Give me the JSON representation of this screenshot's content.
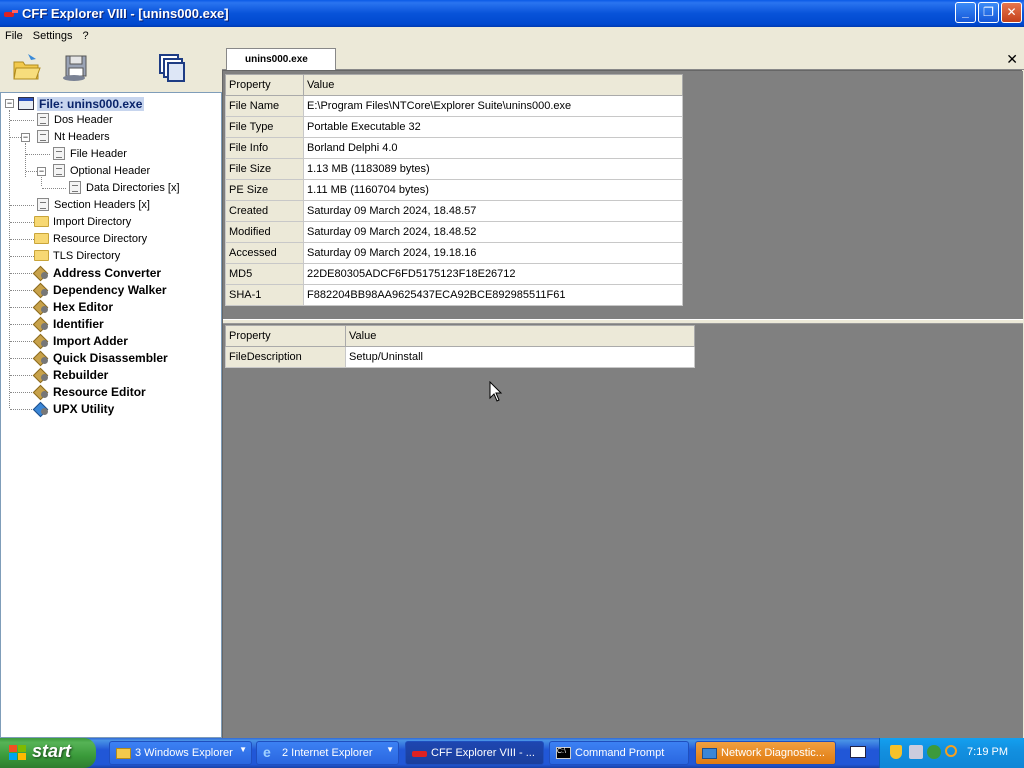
{
  "window": {
    "title": "CFF Explorer VIII - [unins000.exe]",
    "min": "_",
    "max": "❐",
    "close": "✕"
  },
  "menu": [
    "File",
    "Settings",
    "?"
  ],
  "tree": {
    "root": "File: unins000.exe",
    "items": [
      {
        "label": "Dos Header"
      },
      {
        "label": "Nt Headers"
      },
      {
        "label": "File Header"
      },
      {
        "label": "Optional Header"
      },
      {
        "label": "Data Directories [x]"
      },
      {
        "label": "Section Headers [x]"
      },
      {
        "label": "Import Directory"
      },
      {
        "label": "Resource Directory"
      },
      {
        "label": "TLS Directory"
      },
      {
        "label": "Address Converter"
      },
      {
        "label": "Dependency Walker"
      },
      {
        "label": "Hex Editor"
      },
      {
        "label": "Identifier"
      },
      {
        "label": "Import Adder"
      },
      {
        "label": "Quick Disassembler"
      },
      {
        "label": "Rebuilder"
      },
      {
        "label": "Resource Editor"
      },
      {
        "label": "UPX Utility"
      }
    ]
  },
  "tab": {
    "label": "unins000.exe",
    "close": "✕"
  },
  "top_table": {
    "headers": [
      "Property",
      "Value"
    ],
    "rows": [
      [
        "File Name",
        "E:\\Program Files\\NTCore\\Explorer Suite\\unins000.exe"
      ],
      [
        "File Type",
        "Portable Executable 32"
      ],
      [
        "File Info",
        "Borland Delphi 4.0"
      ],
      [
        "File Size",
        "1.13 MB (1183089 bytes)"
      ],
      [
        "PE Size",
        "1.11 MB (1160704 bytes)"
      ],
      [
        "Created",
        "Saturday 09 March 2024, 18.48.57"
      ],
      [
        "Modified",
        "Saturday 09 March 2024, 18.48.52"
      ],
      [
        "Accessed",
        "Saturday 09 March 2024, 19.18.16"
      ],
      [
        "MD5",
        "22DE80305ADCF6FD5175123F18E26712"
      ],
      [
        "SHA-1",
        "F882204BB98AA9625437ECA92BCE892985511F61"
      ]
    ]
  },
  "bottom_table": {
    "headers": [
      "Property",
      "Value"
    ],
    "rows": [
      [
        "FileDescription",
        "Setup/Uninstall"
      ]
    ]
  },
  "taskbar": {
    "start": "start",
    "tasks": [
      {
        "label": "3 Windows Explorer",
        "icon": "folder-icon"
      },
      {
        "label": "2 Internet Explorer",
        "icon": "ie-icon"
      },
      {
        "label": "CFF Explorer VIII - ...",
        "icon": "cff-icon"
      },
      {
        "label": "Command Prompt",
        "icon": "cmd-icon"
      },
      {
        "label": "Network Diagnostic...",
        "icon": "network-icon"
      }
    ],
    "time": "7:19 PM"
  }
}
